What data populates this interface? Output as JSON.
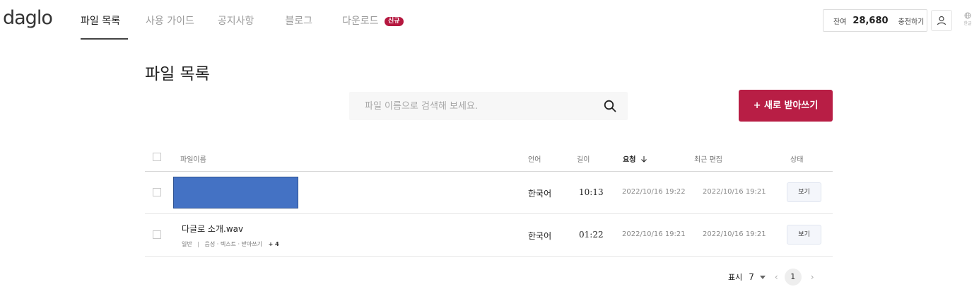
{
  "header": {
    "logo": "daglo",
    "nav": [
      {
        "label": "파일 목록",
        "active": true
      },
      {
        "label": "사용 가이드",
        "active": false
      },
      {
        "label": "공지사항",
        "active": false
      },
      {
        "label": "블로그",
        "active": false
      },
      {
        "label": "다운로드",
        "active": false,
        "badge": "신규"
      }
    ],
    "balance_label": "잔여",
    "balance_amount": "28,680",
    "charge_label": "충전하기",
    "user_icon": "person-icon",
    "language_icon": "language-icon",
    "language_label": "한글"
  },
  "main": {
    "title": "파일 목록",
    "search_placeholder": "파일 이름으로 검색해 보세요.",
    "search_icon": "search-icon",
    "new_button": "+ 새로 받아쓰기",
    "accent_color": "#b81e45"
  },
  "table": {
    "columns": {
      "name": "파일이름",
      "language": "언어",
      "length": "길이",
      "requested": "요청",
      "edited": "최근 편집",
      "status": "상태"
    },
    "rows": [
      {
        "name": "",
        "meta_type": "",
        "meta_desc": "",
        "meta_extra": "",
        "language": "한국어",
        "length": "10:13",
        "requested": "2022/10/16 19:22",
        "edited": "2022/10/16 19:21",
        "action": "보기",
        "redacted": true
      },
      {
        "name": "다글로 소개.wav",
        "meta_type": "일반",
        "meta_desc": "음성 · 텍스트 · 받아쓰기",
        "meta_extra": "+ 4",
        "language": "한국어",
        "length": "01:22",
        "requested": "2022/10/16 19:21",
        "edited": "2022/10/16 19:21",
        "action": "보기",
        "redacted": false
      }
    ]
  },
  "pagination": {
    "display_label": "표시",
    "page_size": "7",
    "current_page": "1"
  }
}
